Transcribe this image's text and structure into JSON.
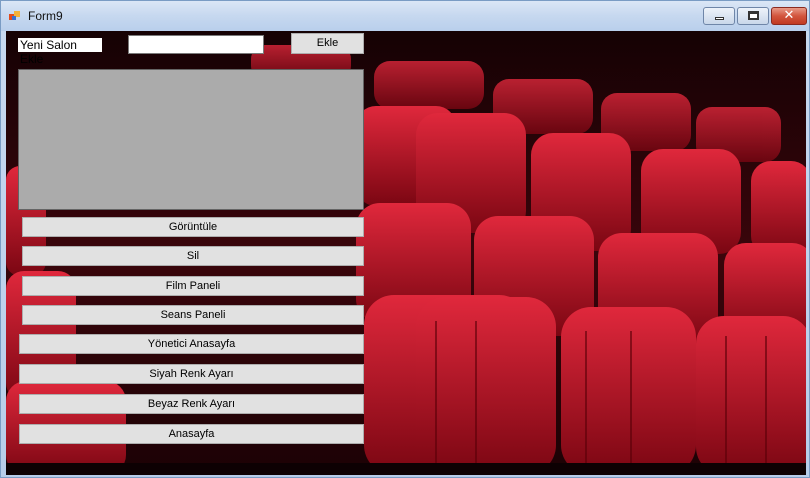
{
  "window": {
    "title": "Form9"
  },
  "form": {
    "new_hall_label": "Yeni Salon Ekle",
    "new_hall_value": "",
    "add_button": "Ekle"
  },
  "buttons": {
    "view": "Görüntüle",
    "delete": "Sil",
    "film_panel": "Film Paneli",
    "session_panel": "Seans Paneli",
    "admin_home": "Yönetici Anasayfa",
    "black_theme": "Siyah Renk Ayarı",
    "white_theme": "Beyaz Renk Ayarı",
    "home": "Anasayfa"
  },
  "colors": {
    "seat_red": "#c41428",
    "listbox_gray": "#ababab"
  }
}
